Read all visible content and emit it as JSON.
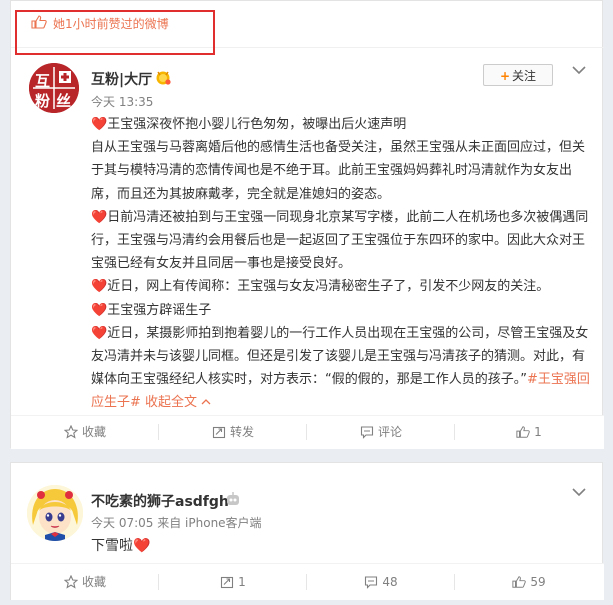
{
  "post1": {
    "liked_text": "她1小时前赞过的微博",
    "avatar_chars": [
      "互",
      "粉",
      "丝"
    ],
    "nickname": "互粉|大厅",
    "time": "今天 13:35",
    "follow_label": "关注",
    "lines": [
      {
        "heart": "❤️",
        "text": "王宝强深夜怀抱小婴儿行色匆匆，被曝出后火速声明"
      },
      {
        "heart": "",
        "text": "自从王宝强与马蓉离婚后他的感情生活也备受关注，虽然王宝强从未正面回应过，但关于其与模特冯清的恋情传闻也是不绝于耳。此前王宝强妈妈葬礼时冯清就作为女友出席，而且还为其披麻戴孝，完全就是准媳妇的姿态。"
      },
      {
        "heart": "❤️",
        "text": "日前冯清还被拍到与王宝强一同现身北京某写字楼，此前二人在机场也多次被偶遇同行，王宝强与冯清约会用餐后也是一起返回了王宝强位于东四环的家中。因此大众对王宝强已经有女友并且同居一事也是接受良好。"
      },
      {
        "heart": "❤️",
        "text": "近日，网上有传闻称：王宝强与女友冯清秘密生子了，引发不少网友的关注。"
      },
      {
        "heart": "❤️",
        "text": "王宝强方辟谣生子"
      },
      {
        "heart": "❤️",
        "text": "近日，某摄影师拍到抱着婴儿的一行工作人员出现在王宝强的公司，尽管王宝强及女友冯清并未与该婴儿同框。但还是引发了该婴儿是王宝强与冯清孩子的猜测。对此，有媒体向王宝强经纪人核实时，对方表示：“假的假的，那是工作人员的孩子。”"
      }
    ],
    "topic": "#王宝强回应生子#",
    "expand": "收起全文",
    "actions": {
      "collect": "收藏",
      "repost": "转发",
      "comment": "评论",
      "like": "1"
    }
  },
  "post2": {
    "nickname": "不吃素的狮子asdfgh",
    "time": "今天 07:05",
    "source": "来自 iPhone客户端",
    "text": "下雪啦",
    "heart": "❤️",
    "actions": {
      "collect": "收藏",
      "repost": "1",
      "comment": "48",
      "like": "59"
    }
  },
  "colors": {
    "accent": "#eb7350",
    "heart": "#e0302c",
    "red_box": "#e02d2d",
    "follow_plus": "#ff8200"
  }
}
